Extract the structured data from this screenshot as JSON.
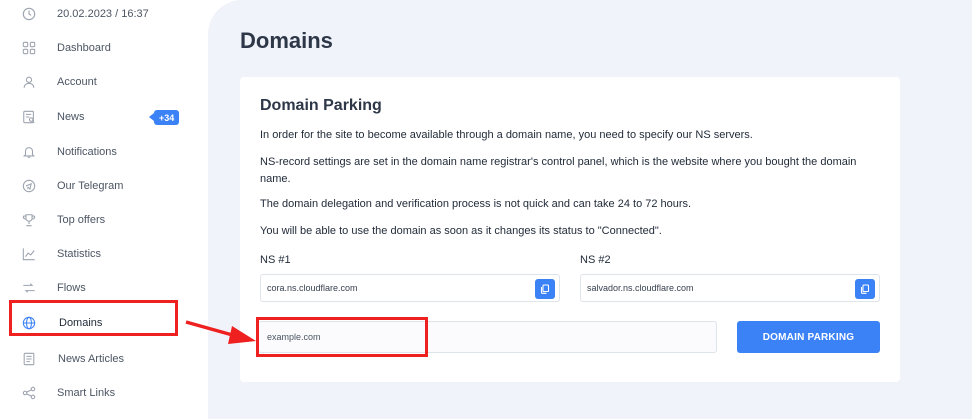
{
  "sidebar": {
    "datetime": "20.02.2023 / 16:37",
    "items": [
      {
        "label": "Dashboard"
      },
      {
        "label": "Account"
      },
      {
        "label": "News"
      },
      {
        "label": "Notifications"
      },
      {
        "label": "Our Telegram"
      },
      {
        "label": "Top offers"
      },
      {
        "label": "Statistics"
      },
      {
        "label": "Flows"
      },
      {
        "label": "Domains"
      },
      {
        "label": "News Articles"
      },
      {
        "label": "Smart Links"
      }
    ],
    "news_badge": "+34",
    "active_item": "Domains"
  },
  "page": {
    "title": "Domains"
  },
  "card": {
    "title": "Domain Parking",
    "paragraphs": [
      "In order for the site to become available through a domain name, you need to specify our NS servers.",
      "NS-record settings are set in the domain name registrar's control panel, which is the website where you bought the domain name.",
      "The domain delegation and verification process is not quick and can take 24 to 72 hours.",
      "You will be able to use the domain as soon as it changes its status to \"Connected\"."
    ],
    "ns1_label": "NS #1",
    "ns1_value": "cora.ns.cloudflare.com",
    "ns2_label": "NS #2",
    "ns2_value": "salvador.ns.cloudflare.com",
    "domain_placeholder": "example.com",
    "park_button": "DOMAIN PARKING"
  },
  "colors": {
    "accent": "#3b82f6",
    "highlight": "#ef2020",
    "main_bg": "#f1f3fa"
  }
}
